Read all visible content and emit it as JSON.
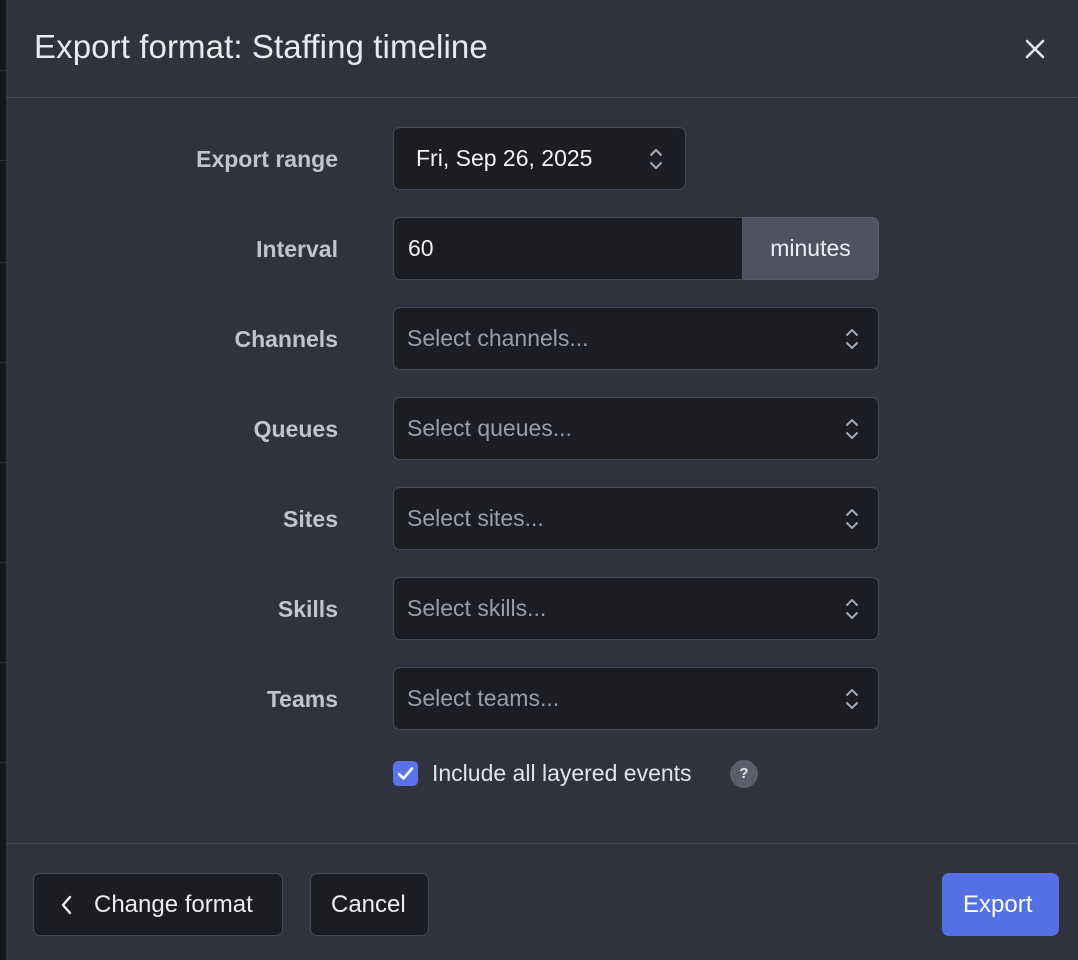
{
  "dialog": {
    "title": "Export format: Staffing timeline",
    "close_icon": "close-icon"
  },
  "form": {
    "export_range": {
      "label": "Export range",
      "value": "Fri, Sep 26, 2025",
      "icon": "up-down-chevron-icon"
    },
    "interval": {
      "label": "Interval",
      "value": "60",
      "unit": "minutes"
    },
    "channels": {
      "label": "Channels",
      "placeholder": "Select channels..."
    },
    "queues": {
      "label": "Queues",
      "placeholder": "Select queues..."
    },
    "sites": {
      "label": "Sites",
      "placeholder": "Select sites..."
    },
    "skills": {
      "label": "Skills",
      "placeholder": "Select skills..."
    },
    "teams": {
      "label": "Teams",
      "placeholder": "Select teams..."
    },
    "layered_events": {
      "label": "Include all layered events",
      "checked": true,
      "help": "?"
    }
  },
  "footer": {
    "change_format_label": "Change format",
    "cancel_label": "Cancel",
    "export_label": "Export"
  },
  "colors": {
    "modal_background": "#30323d",
    "field_background": "#1c1d22",
    "accent": "#5570e3",
    "unit_addon": "#4e5263"
  }
}
